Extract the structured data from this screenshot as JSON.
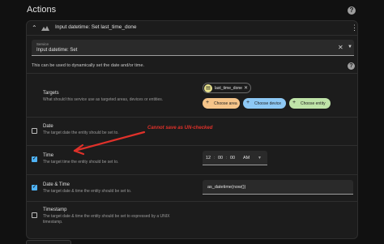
{
  "header": {
    "title": "Actions"
  },
  "card": {
    "title": "Input datetime: Set last_time_done",
    "service": {
      "label": "Service",
      "value": "Input datetime: Set"
    },
    "description": "This can be used to dynamically set the date and/or time.",
    "targets": {
      "title": "Targets",
      "subtitle": "What should this service use as targeted areas, devices or entities.",
      "chip_label": "last_time_done",
      "buttons": [
        {
          "label": "Choose area",
          "color": "#f6c58a"
        },
        {
          "label": "Choose device",
          "color": "#8ec9f5"
        },
        {
          "label": "Choose entity",
          "color": "#bfe3a8"
        }
      ]
    },
    "fields": [
      {
        "title": "Date",
        "subtitle": "The target date the entity should be set to.",
        "checked": false
      },
      {
        "title": "Time",
        "subtitle": "The target time the entity should be set to.",
        "checked": true
      },
      {
        "title": "Date & Time",
        "subtitle": "The target date & time the entity should be set to.",
        "checked": true
      },
      {
        "title": "Timestamp",
        "subtitle_line1": "The target date & time the entity should be set to expressed by a UNIX",
        "subtitle_line2": "timestamp.",
        "checked": false
      }
    ],
    "time_value": {
      "hours": "12",
      "minutes": "00",
      "seconds": "00",
      "period": "AM"
    },
    "datetime_value": "as_datetime(now())"
  },
  "annotation": "Cannot save as UN-checked",
  "colors": {
    "accent": "#4fb3f6",
    "annotation": "#e0312a"
  },
  "icons": {
    "help": "help-circle-icon",
    "collapse": "chevron-up-icon",
    "menu": "dots-vertical-icon",
    "clear": "close-icon",
    "dropdown": "menu-down-icon"
  }
}
